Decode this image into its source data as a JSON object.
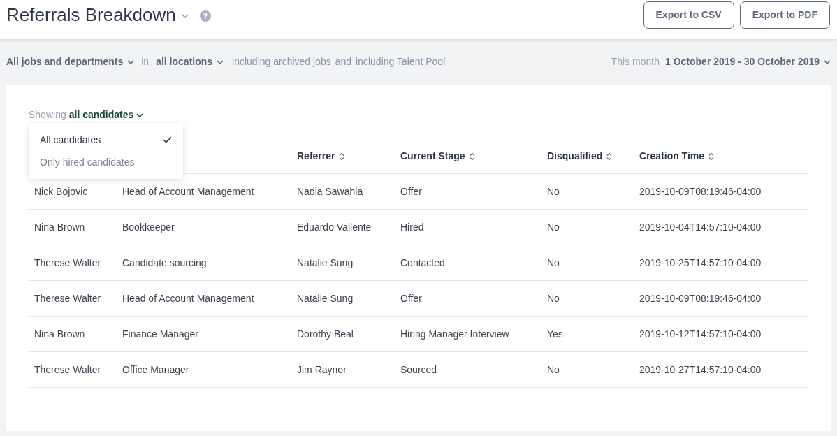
{
  "header": {
    "title": "Referrals Breakdown",
    "help": "?",
    "buttons": [
      "Export to CSV",
      "Export to PDF"
    ]
  },
  "filters": {
    "jobs": "All jobs and departments",
    "in": "in",
    "locations": "all locations",
    "archived_link": "including archived jobs",
    "and": "and",
    "talent_pool_link": "including Talent Pool",
    "period_label": "This month",
    "date_range": "1 October 2019 - 30 October 2019"
  },
  "showing": {
    "label": "Showing",
    "value": "all candidates",
    "menu": [
      {
        "label": "All candidates",
        "selected": true
      },
      {
        "label": "Only hired candidates",
        "selected": false
      }
    ]
  },
  "table": {
    "columns": [
      null,
      null,
      "Referrer",
      "Current Stage",
      "Disqualified",
      "Creation Time"
    ],
    "rows": [
      [
        "Nick Bojovic",
        "Head of Account Management",
        "Nadia Sawahla",
        "Offer",
        "No",
        "2019-10-09T08:19:46-04:00"
      ],
      [
        "Nina Brown",
        "Bookkeeper",
        "Eduardo Vallente",
        "Hired",
        "No",
        "2019-10-04T14:57:10-04:00"
      ],
      [
        "Therese Walter",
        "Candidate sourcing",
        "Natalie Sung",
        "Contacted",
        "No",
        "2019-10-25T14:57:10-04:00"
      ],
      [
        "Therese Walter",
        "Head of Account Management",
        "Natalie Sung",
        "Offer",
        "No",
        "2019-10-09T08:19:46-04:00"
      ],
      [
        "Nina Brown",
        "Finance Manager",
        "Dorothy Beal",
        "Hiring Manager Interview",
        "Yes",
        "2019-10-12T14:57:10-04:00"
      ],
      [
        "Therese Walter",
        "Office Manager",
        "Jim Raynor",
        "Sourced",
        "No",
        "2019-10-27T14:57:10-04:00"
      ]
    ]
  }
}
